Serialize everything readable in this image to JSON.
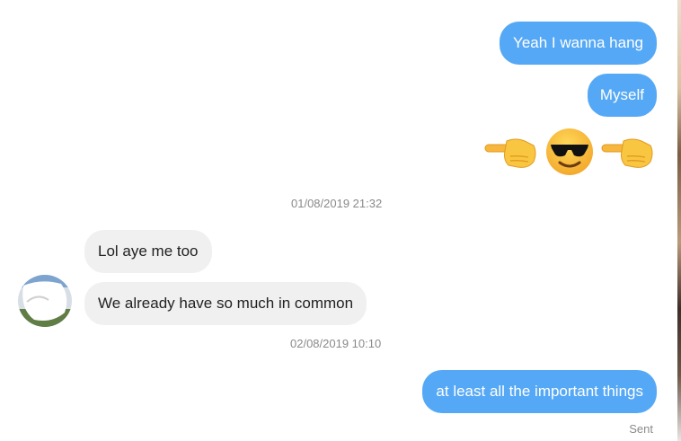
{
  "messages": [
    {
      "text": "Yeah I wanna hang",
      "direction": "outgoing"
    },
    {
      "text": "Myself",
      "direction": "outgoing"
    },
    {
      "text": "Lol aye me too",
      "direction": "incoming"
    },
    {
      "text": "We already have so much in common",
      "direction": "incoming"
    },
    {
      "text": "at least all the important things",
      "direction": "outgoing"
    }
  ],
  "emoji_message": {
    "icons": [
      "pointing-right-hand-icon",
      "sunglasses-smiley-icon",
      "pointing-right-hand-icon"
    ]
  },
  "timestamps": [
    "01/08/2019 21:32",
    "02/08/2019 10:10"
  ],
  "status": {
    "sent": "Sent"
  },
  "colors": {
    "outgoing_bubble": "#55a8f5",
    "incoming_bubble": "#f0f0f0",
    "timestamp_text": "#8a8a8a"
  }
}
